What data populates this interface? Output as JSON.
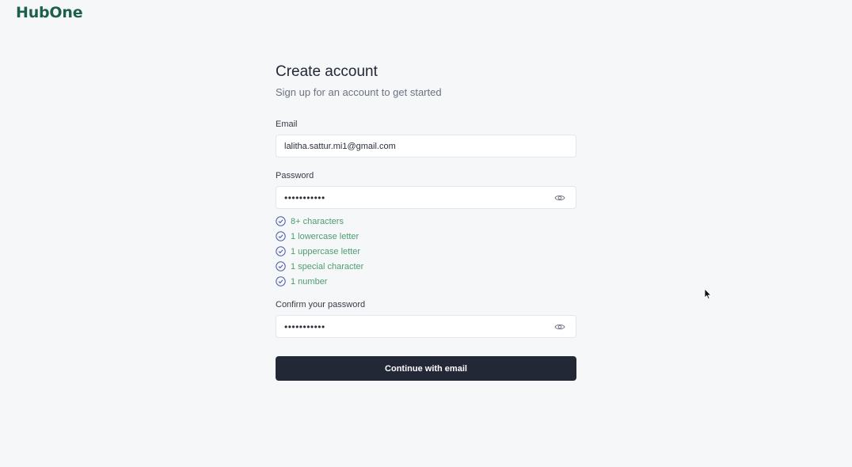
{
  "brand": {
    "logo_text": "HubOne",
    "color": "#1e5f4a"
  },
  "signup": {
    "title": "Create account",
    "subtitle": "Sign up for an account to get started",
    "email": {
      "label": "Email",
      "value": "lalitha.sattur.mi1@gmail.com"
    },
    "password": {
      "label": "Password",
      "masked_value": "•••••••••••",
      "toggle_icon": "eye-icon"
    },
    "requirements": [
      {
        "text": "8+ characters",
        "met": true
      },
      {
        "text": "1 lowercase letter",
        "met": true
      },
      {
        "text": "1 uppercase letter",
        "met": true
      },
      {
        "text": "1 special character",
        "met": true
      },
      {
        "text": "1 number",
        "met": true
      }
    ],
    "confirm_password": {
      "label": "Confirm your password",
      "masked_value": "•••••••••••",
      "toggle_icon": "eye-icon"
    },
    "submit_label": "Continue with email"
  },
  "colors": {
    "background": "#f6f7f9",
    "button": "#232836",
    "requirement_met": "#4d9c72",
    "check_icon": "#4a5aa8"
  }
}
